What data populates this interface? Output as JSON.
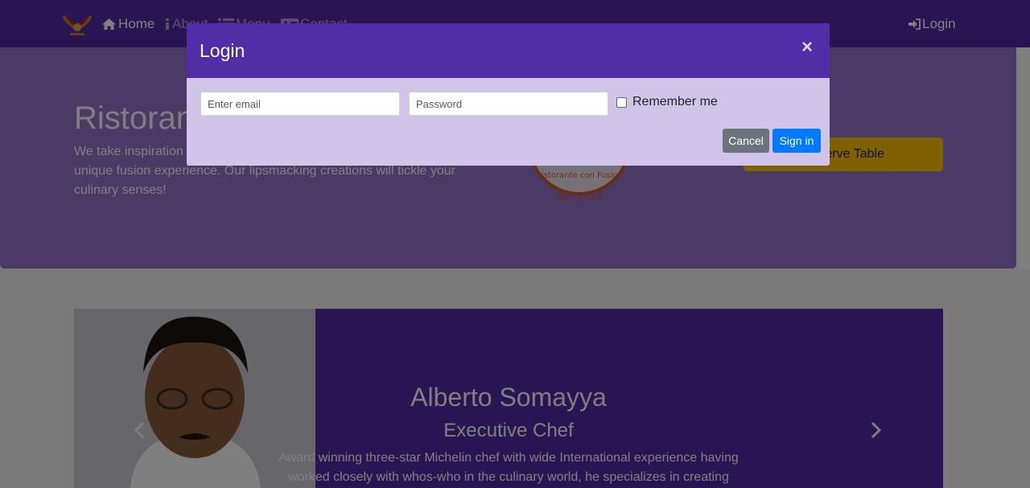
{
  "nav": {
    "items": [
      {
        "label": "Home",
        "icon": "home-icon"
      },
      {
        "label": "About",
        "icon": "info-icon"
      },
      {
        "label": "Menu",
        "icon": "list-icon"
      },
      {
        "label": "Contact",
        "icon": "address-card-icon"
      }
    ],
    "login_label": "Login"
  },
  "jumbotron": {
    "title": "Ristorante con Fusion",
    "text": "We take inspiration from the World's best cuisines, and create a unique fusion experience. Our lipsmacking creations will tickle your culinary senses!",
    "reserve_label": "Reserve Table",
    "seal": {
      "text": "Ristorante con Fusion",
      "established": "Est. 2013"
    }
  },
  "carousel": {
    "name": "Alberto Somayya",
    "role": "Executive Chef",
    "bio": "Award winning three-star Michelin chef with wide International experience having worked closely with whos-who in the culinary world, he specializes in creating"
  },
  "modal": {
    "title": "Login",
    "close_symbol": "×",
    "email_placeholder": "Enter email",
    "password_placeholder": "Password",
    "remember_label": "Remember me",
    "cancel_label": "Cancel",
    "signin_label": "Sign in"
  },
  "colors": {
    "primary": "#512DA8",
    "primary_light": "#9575CD",
    "modal_body": "#D1C4E9",
    "reserve": "#FFC107",
    "signin": "#007bff",
    "cancel": "#6c757d"
  }
}
